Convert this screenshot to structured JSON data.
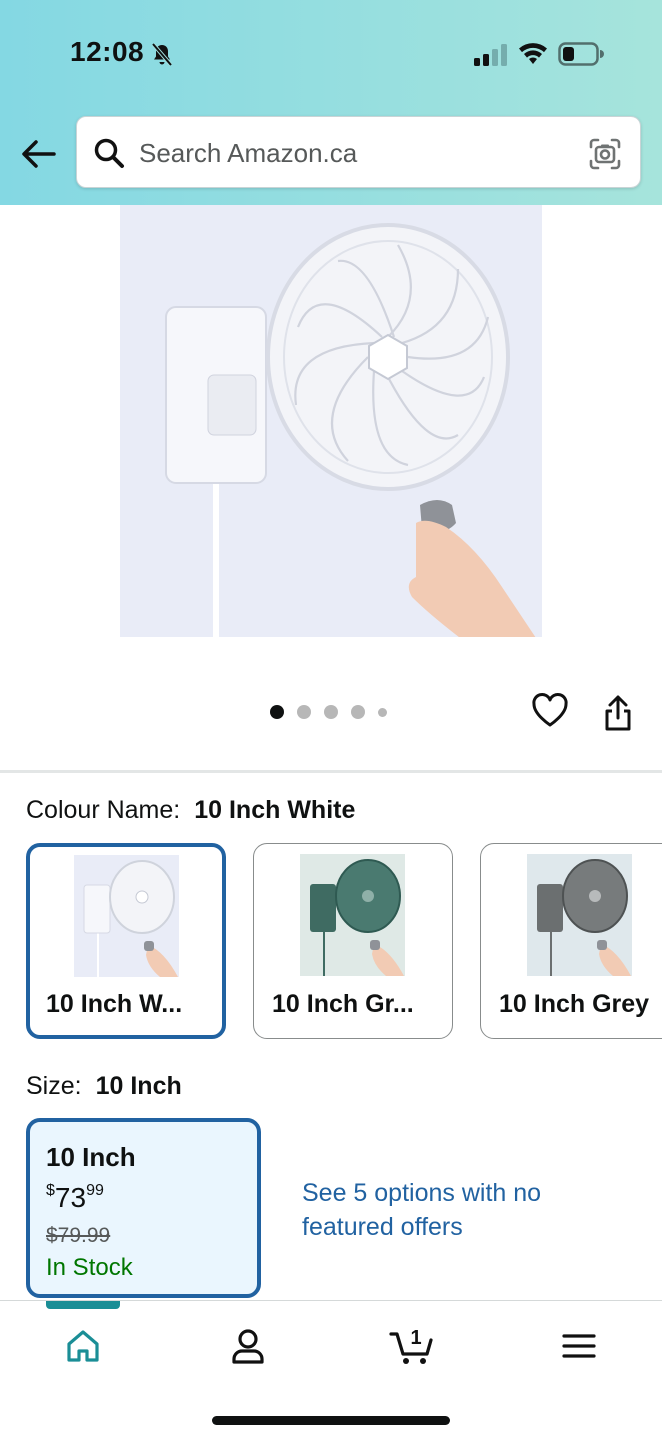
{
  "status_bar": {
    "time": "12:08",
    "icons": [
      "bell-slash-icon",
      "signal-icon",
      "wifi-icon",
      "battery-icon"
    ]
  },
  "header": {
    "back_icon": "arrow-left-icon",
    "search": {
      "placeholder": "Search Amazon.ca",
      "search_icon": "search-icon",
      "camera_icon": "camera-icon"
    },
    "colors": {
      "gradient_start": "#84d8e3",
      "gradient_end": "#a6e4dc"
    }
  },
  "product": {
    "image": "product-image",
    "carousel": {
      "count": 5,
      "active": 1
    },
    "wishlist_icon": "heart-icon",
    "share_icon": "share-icon"
  },
  "colour": {
    "label": "Colour Name:",
    "selected": "10 Inch White",
    "options": [
      {
        "label": "10 Inch W...",
        "selected": true,
        "fan_color": "#ffffff",
        "bg": "#e9ecf7"
      },
      {
        "label": "10 Inch Gr...",
        "selected": false,
        "fan_color": "#3f6b62",
        "bg": "#dfe9e6"
      },
      {
        "label": "10 Inch Grey",
        "selected": false,
        "fan_color": "#6b6f70",
        "bg": "#dfe8ec"
      }
    ]
  },
  "size": {
    "label": "Size:",
    "selected": "10 Inch",
    "card": {
      "title": "10 Inch",
      "currency": "$",
      "price_dollars": "73",
      "price_cents": "99",
      "list_price": "$79.99",
      "stock": "In Stock"
    },
    "see_options": "See 5 options with no featured offers"
  },
  "tabbar": {
    "items": [
      {
        "name": "home",
        "icon": "home-icon",
        "active": true
      },
      {
        "name": "account",
        "icon": "user-icon",
        "active": false
      },
      {
        "name": "cart",
        "icon": "cart-icon",
        "active": false,
        "badge": "1"
      },
      {
        "name": "menu",
        "icon": "menu-icon",
        "active": false
      }
    ],
    "colors": {
      "accent": "#1a8e96",
      "link": "#2162a1",
      "stock": "#007600"
    }
  }
}
